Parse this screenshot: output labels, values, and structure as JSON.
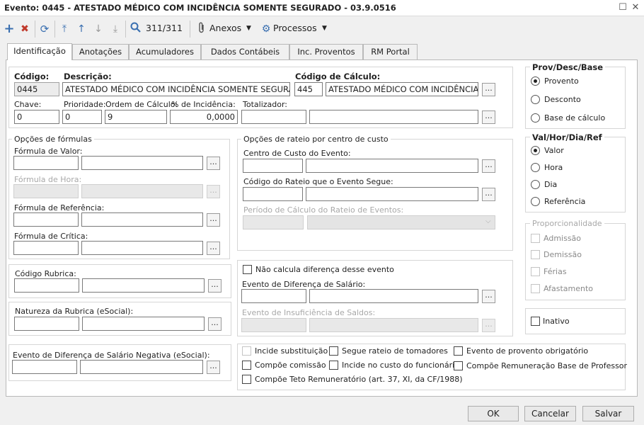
{
  "window": {
    "title": "Evento: 0445 - ATESTADO MÉDICO COM INCIDÊNCIA SOMENTE SEGURADO - 03.9.0516"
  },
  "toolbar": {
    "record_counter": "311/311",
    "anexos_label": "Anexos",
    "processos_label": "Processos"
  },
  "tabs": [
    "Identificação",
    "Anotações",
    "Acumuladores",
    "Dados Contábeis",
    "Inc. Proventos",
    "RM Portal"
  ],
  "main": {
    "codigo_label": "Código:",
    "codigo_value": "0445",
    "descricao_label": "Descrição:",
    "descricao_value": "ATESTADO MÉDICO COM INCIDÊNCIA SOMENTE SEGURADO",
    "codigo_calculo_label": "Código de Cálculo:",
    "codigo_calculo_value": "445",
    "codigo_calculo_desc": "ATESTADO MÉDICO COM INCIDÊNCIA SC",
    "chave_label": "Chave:",
    "chave_value": "0",
    "prioridade_label": "Prioridade:",
    "prioridade_value": "0",
    "ordem_label": "Ordem de Cálculo:",
    "ordem_value": "9",
    "incidencia_label": "% de Incidência:",
    "incidencia_value": "0,0000",
    "totalizador_label": "Totalizador:"
  },
  "formulas": {
    "group_label": "Opções de fórmulas",
    "valor_label": "Fórmula de Valor:",
    "hora_label": "Fórmula de Hora:",
    "referencia_label": "Fórmula de Referência:",
    "critica_label": "Fórmula de Crítica:"
  },
  "rateio": {
    "group_label": "Opções de rateio por centro de custo",
    "centro_label": "Centro de Custo do Evento:",
    "codigo_rateio_label": "Código do Rateio que o Evento Segue:",
    "periodo_label": "Período de Cálculo do Rateio de Eventos:"
  },
  "rubrica": {
    "codigo_label": "Código Rubrica:",
    "natureza_label": "Natureza da Rubrica (eSocial):",
    "negativa_label": "Evento de Diferença de Salário Negativa (eSocial):"
  },
  "diferenca": {
    "nao_calcula_label": "Não calcula diferença desse evento",
    "evento_dif_label": "Evento de Diferença de Salário:",
    "insuficiencia_label": "Evento de Insuficiência de Saldos:"
  },
  "checks": {
    "incide_substituicao": "Incide substituição",
    "segue_rateio": "Segue rateio de tomadores",
    "provento_obrigatorio": "Evento de provento obrigatório",
    "compoe_comissao": "Compõe comissão",
    "incide_custo": "Incide no custo do funcionário",
    "compoe_professor": "Compõe Remuneração Base de Professor",
    "compoe_teto": "Compõe Teto Remuneratório (art. 37, XI, da CF/1988)"
  },
  "prov": {
    "group_label": "Prov/Desc/Base",
    "options": [
      "Provento",
      "Desconto",
      "Base de cálculo"
    ]
  },
  "val": {
    "group_label": "Val/Hor/Dia/Ref",
    "options": [
      "Valor",
      "Hora",
      "Dia",
      "Referência"
    ]
  },
  "proporcionalidade": {
    "group_label": "Proporcionalidade",
    "options": [
      "Admissão",
      "Demissão",
      "Férias",
      "Afastamento"
    ]
  },
  "inativo_label": "Inativo",
  "buttons": {
    "ok": "OK",
    "cancelar": "Cancelar",
    "salvar": "Salvar"
  },
  "lookup_label": "...",
  "colors": {
    "accent_blue": "#3a6fb0",
    "delete_red": "#c0392b"
  }
}
